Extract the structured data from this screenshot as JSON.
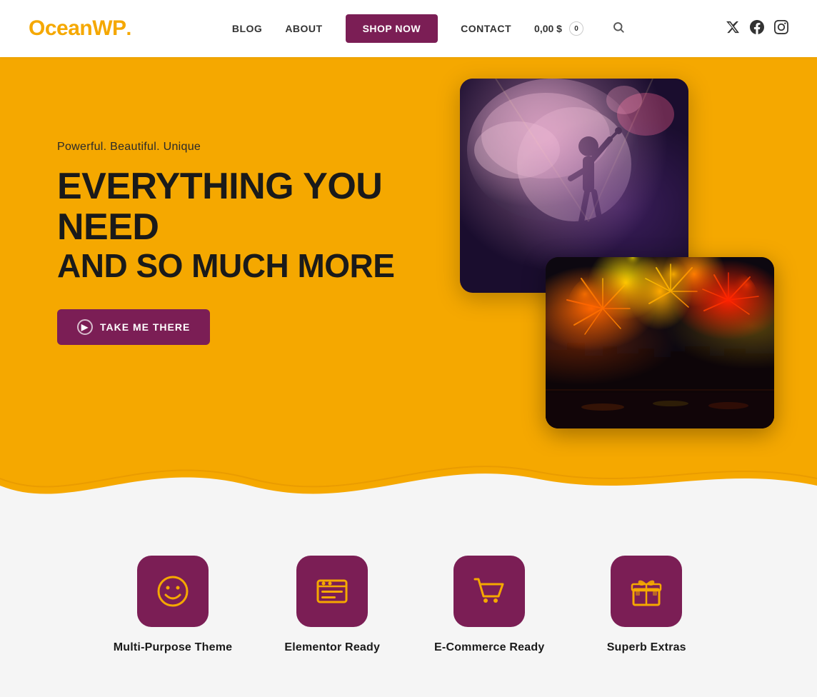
{
  "brand": {
    "name": "OceanWP",
    "dot": "."
  },
  "nav": {
    "blog": "BLOG",
    "about": "ABOUT",
    "shop_now": "SHOP NOW",
    "contact": "CONTACT",
    "cart_price": "0,00 $",
    "cart_count": "0"
  },
  "hero": {
    "subtitle": "Powerful. Beautiful. Unique",
    "title_line1": "EVERYTHING YOU NEED",
    "title_line2": "AND SO MUCH MORE",
    "cta": "TAKE ME THERE"
  },
  "features": [
    {
      "id": "multi-purpose",
      "icon": "😊",
      "label": "Multi-Purpose Theme"
    },
    {
      "id": "elementor",
      "icon": "🪪",
      "label": "Elementor Ready"
    },
    {
      "id": "ecommerce",
      "icon": "🛒",
      "label": "E-Commerce Ready"
    },
    {
      "id": "extras",
      "icon": "🎁",
      "label": "Superb Extras"
    }
  ],
  "social": {
    "twitter": "𝕏",
    "facebook": "f",
    "instagram": "📷"
  }
}
